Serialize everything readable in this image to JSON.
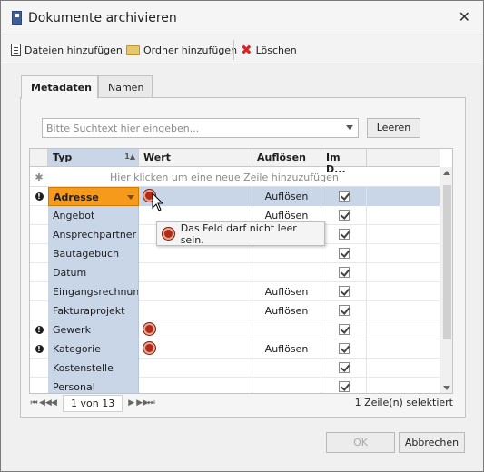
{
  "window": {
    "title": "Dokumente archivieren"
  },
  "toolbar": {
    "add_files": "Dateien hinzufügen",
    "add_folder": "Ordner hinzufügen",
    "delete": "Löschen"
  },
  "tabs": [
    {
      "label": "Metadaten"
    },
    {
      "label": "Namen"
    }
  ],
  "search": {
    "placeholder": "Bitte Suchtext hier eingeben...",
    "clear_label": "Leeren"
  },
  "grid": {
    "columns": {
      "typ": "Typ",
      "sort_index": "1",
      "wert": "Wert",
      "aufloesen": "Auflösen",
      "imd": "Im D..."
    },
    "new_row_text": "Hier klicken um eine neue Zeile hinzuzufügen",
    "new_row_icon": "asterisk-icon",
    "rows": [
      {
        "typ": "Adresse",
        "aufloesen": "Auflösen",
        "checked": true,
        "warning": true,
        "error": true,
        "selected": true
      },
      {
        "typ": "Angebot",
        "aufloesen": "Auflösen",
        "checked": true
      },
      {
        "typ": "Ansprechpartner",
        "aufloesen": "",
        "checked": true
      },
      {
        "typ": "Bautagebuch",
        "aufloesen": "",
        "checked": true
      },
      {
        "typ": "Datum",
        "aufloesen": "",
        "checked": true
      },
      {
        "typ": "Eingangsrechnung",
        "aufloesen": "Auflösen",
        "checked": true
      },
      {
        "typ": "Fakturaprojekt",
        "aufloesen": "Auflösen",
        "checked": true
      },
      {
        "typ": "Gewerk",
        "aufloesen": "",
        "checked": true,
        "warning": true,
        "error": true
      },
      {
        "typ": "Kategorie",
        "aufloesen": "Auflösen",
        "checked": true,
        "warning": true,
        "error": true
      },
      {
        "typ": "Kostenstelle",
        "aufloesen": "",
        "checked": true
      },
      {
        "typ": "Personal",
        "aufloesen": "",
        "checked": true
      }
    ]
  },
  "tooltip": {
    "text": "Das Feld darf nicht leer sein."
  },
  "pager": {
    "page_text": "1 von 13",
    "status": "1 Zeile(n) selektiert"
  },
  "buttons": {
    "ok": "OK",
    "cancel": "Abbrechen"
  },
  "colors": {
    "selection": "#c9d6e8",
    "active_cell": "#f59a1b",
    "error": "#b32a1a"
  }
}
